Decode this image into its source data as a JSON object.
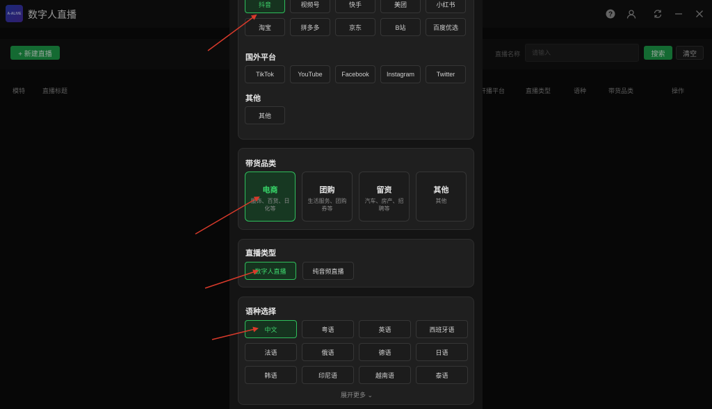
{
  "app": {
    "logo_text": "A-ALIVE",
    "title": "数字人直播"
  },
  "window_icons": [
    "help-icon",
    "user-icon",
    "refresh-icon",
    "minimize-icon",
    "close-icon"
  ],
  "toolbar": {
    "new_label": "+ 新建直播",
    "search_label": "直播名称",
    "search_placeholder": "请输入",
    "search_button": "搜索",
    "clear_button": "清空"
  },
  "table": {
    "headers_left": [
      "模特",
      "直播标题"
    ],
    "headers_right": [
      "开播平台",
      "直播类型",
      "语种",
      "带货品类",
      "操作"
    ]
  },
  "platforms": {
    "domestic_row1": [
      "抖音",
      "视频号",
      "快手",
      "美团",
      "小红书"
    ],
    "domestic_row2": [
      "淘宝",
      "拼多多",
      "京东",
      "B站",
      "百度优选"
    ],
    "foreign_title": "国外平台",
    "foreign": [
      "TikTok",
      "YouTube",
      "Facebook",
      "Instagram",
      "Twitter"
    ],
    "other_title": "其他",
    "other": [
      "其他"
    ],
    "selected": "抖音"
  },
  "category": {
    "title": "带货品类",
    "items": [
      {
        "title": "电商",
        "desc": "服饰、百货、日化等"
      },
      {
        "title": "团购",
        "desc": "生活服务、团购券等"
      },
      {
        "title": "留资",
        "desc": "汽车、房产、招聘等"
      },
      {
        "title": "其他",
        "desc": "其他"
      }
    ],
    "selected": "电商"
  },
  "live_type": {
    "title": "直播类型",
    "items": [
      "数字人直播",
      "纯音频直播"
    ],
    "selected": "数字人直播"
  },
  "language": {
    "title": "语种选择",
    "items": [
      "中文",
      "粤语",
      "英语",
      "西班牙语",
      "法语",
      "俄语",
      "德语",
      "日语",
      "韩语",
      "印尼语",
      "越南语",
      "泰语"
    ],
    "selected": "中文",
    "expand_label": "展开更多 ⌄"
  },
  "colors": {
    "accent": "#1fa34d",
    "active_text": "#3ed46c",
    "annotation": "#d93a2b"
  }
}
